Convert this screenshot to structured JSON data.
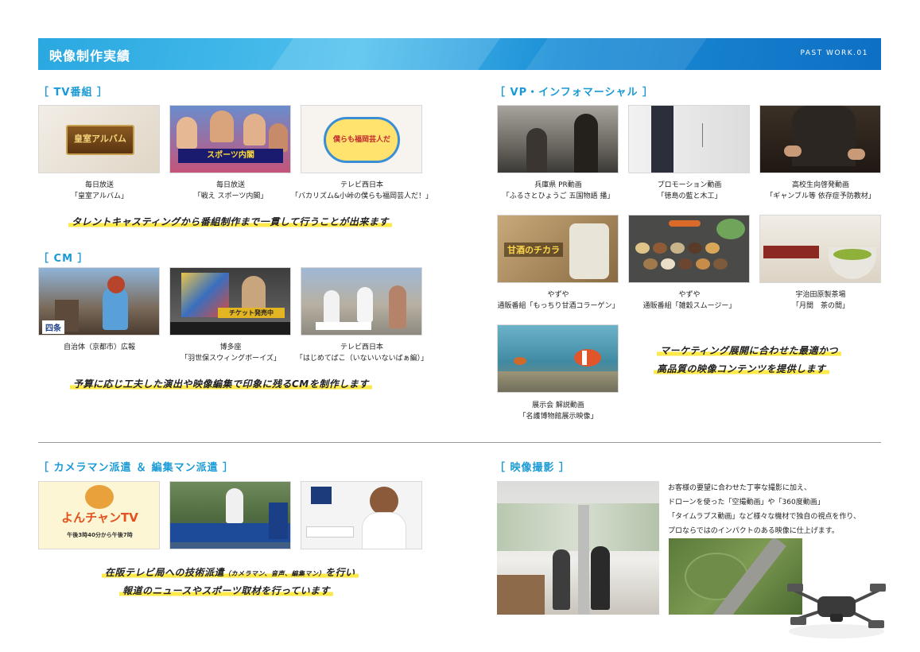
{
  "header": {
    "title": "映像制作実績",
    "page_label": "PAST WORK.01"
  },
  "tv": {
    "label": "［ TV番組 ］",
    "items": [
      {
        "line1": "毎日放送",
        "line2": "「皇室アルバム」",
        "thumb_text": "皇室アルバム"
      },
      {
        "line1": "毎日放送",
        "line2": "「戦え スポーツ内閣」",
        "thumb_text": "スポーツ内閣"
      },
      {
        "line1": "テレビ西日本",
        "line2": "「バカリズム&小峠の僕らも福岡芸人だ！」",
        "thumb_text": "僕らも福岡芸人だ"
      }
    ],
    "tagline": "タレントキャスティングから番組制作まで一貫して行うことが出来ます"
  },
  "cm": {
    "label": "［ CM ］",
    "items": [
      {
        "line1": "自治体（京都市）広報",
        "line2": "",
        "thumb_text": "四条"
      },
      {
        "line1": "博多座",
        "line2": "「羽世保スウィングボーイズ」",
        "thumb_text": "チケット発売中"
      },
      {
        "line1": "テレビ西日本",
        "line2": "「はじめてばこ（いないいないばぁ編）」",
        "thumb_text": ""
      }
    ],
    "tagline": "予算に応じ工夫した演出や映像編集で印象に残るCMを制作します"
  },
  "vp": {
    "label": "［ VP・インフォマーシャル ］",
    "items": [
      {
        "line1": "兵庫県 PR動画",
        "line2": "「ふるさとひょうご 五国物語 播」"
      },
      {
        "line1": "プロモーション動画",
        "line2": "「徳島の藍と木工」"
      },
      {
        "line1": "高校生向啓発動画",
        "line2": "「ギャンブル等 依存症予防教材」"
      },
      {
        "line1": "やずや",
        "line2": "通販番組「もっちり甘酒コラーゲン」",
        "thumb_text": "甘酒のチカラ"
      },
      {
        "line1": "やずや",
        "line2": "通販番組「雑穀スムージー」"
      },
      {
        "line1": "宇治田原製茶場",
        "line2": "「月間　茶の間」"
      },
      {
        "line1": "展示会 解説動画",
        "line2": "「名護博物館展示映像」"
      }
    ],
    "tagline1": "マーケティング展開に合わせた最適かつ",
    "tagline2": "高品質の映像コンテンツを提供します"
  },
  "camera": {
    "label": "［ カメラマン派遣 ＆ 編集マン派遣 ］",
    "thumb1_title": "よんチャンTV",
    "thumb1_sub": "午後3時40分から午後7時",
    "tagline1_a": "在阪テレビ局への技術派遣",
    "tagline1_small": "（カメラマン、音声、編集マン）",
    "tagline1_b": "を行い",
    "tagline2": "報道のニュースやスポーツ取材を行っています"
  },
  "shooting": {
    "label": "［ 映像撮影 ］",
    "lines": [
      "お客様の要望に合わせた丁寧な撮影に加え、",
      "ドローンを使った「空撮動画」や「360度動画」",
      "「タイムラプス動画」など様々な機材で独自の視点を作り、",
      "プロならではのインパクトのある映像に仕上げます。"
    ]
  },
  "colors": {
    "accent": "#1a9ad6",
    "highlight": "#fde94a"
  }
}
